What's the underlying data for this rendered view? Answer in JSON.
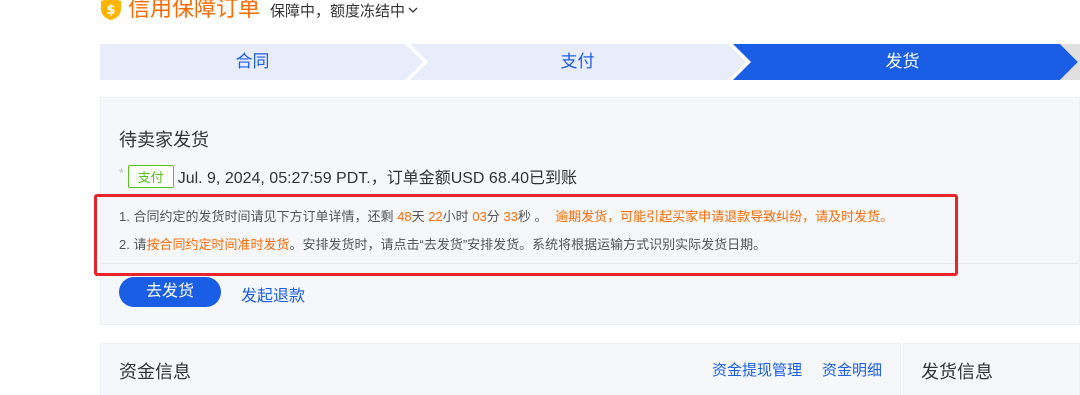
{
  "header": {
    "title": "信用保障订单",
    "status": "保障中，额度冻结中",
    "accent": "#ff6a00"
  },
  "steps": [
    {
      "label": "合同",
      "state": "done"
    },
    {
      "label": "支付",
      "state": "done"
    },
    {
      "label": "发货",
      "state": "active"
    }
  ],
  "panel": {
    "title": "待卖家发货",
    "pay_dot": "*",
    "pay_tag": "支付",
    "pay_text": "Jul. 9, 2024, 05:27:59 PDT.，订单金额USD 68.40已到账",
    "notice1": {
      "prefix": "1. 合同约定的发货时间请见下方订单详情，还剩",
      "days": "48",
      "days_unit": "天",
      "hours": "22",
      "hours_unit": "小时",
      "minutes": "03",
      "minutes_unit": "分",
      "seconds": "33",
      "seconds_unit": "秒 。",
      "warning": "逾期发货，可能引起买家申请退款导致纠纷，请及时发货。"
    },
    "notice2": {
      "prefix": "2. 请",
      "highlight": "按合同约定时间准时发货",
      "suffix": "。安排发货时，请点击“去发货”安排发货。系统将根据运输方式识别实际发货日期。"
    },
    "ship_button": "去发货",
    "refund_link": "发起退款"
  },
  "fund": {
    "title": "资金信息",
    "link_withdraw": "资金提现管理",
    "link_detail": "资金明细"
  },
  "shipping": {
    "title": "发货信息"
  },
  "colors": {
    "primary": "#1a5ee6",
    "step_inactive_bg": "#e8ecfb",
    "step_active_bg": "#1a5ee6",
    "tag_green": "#52c41a",
    "highlight_red": "#e8232a"
  }
}
